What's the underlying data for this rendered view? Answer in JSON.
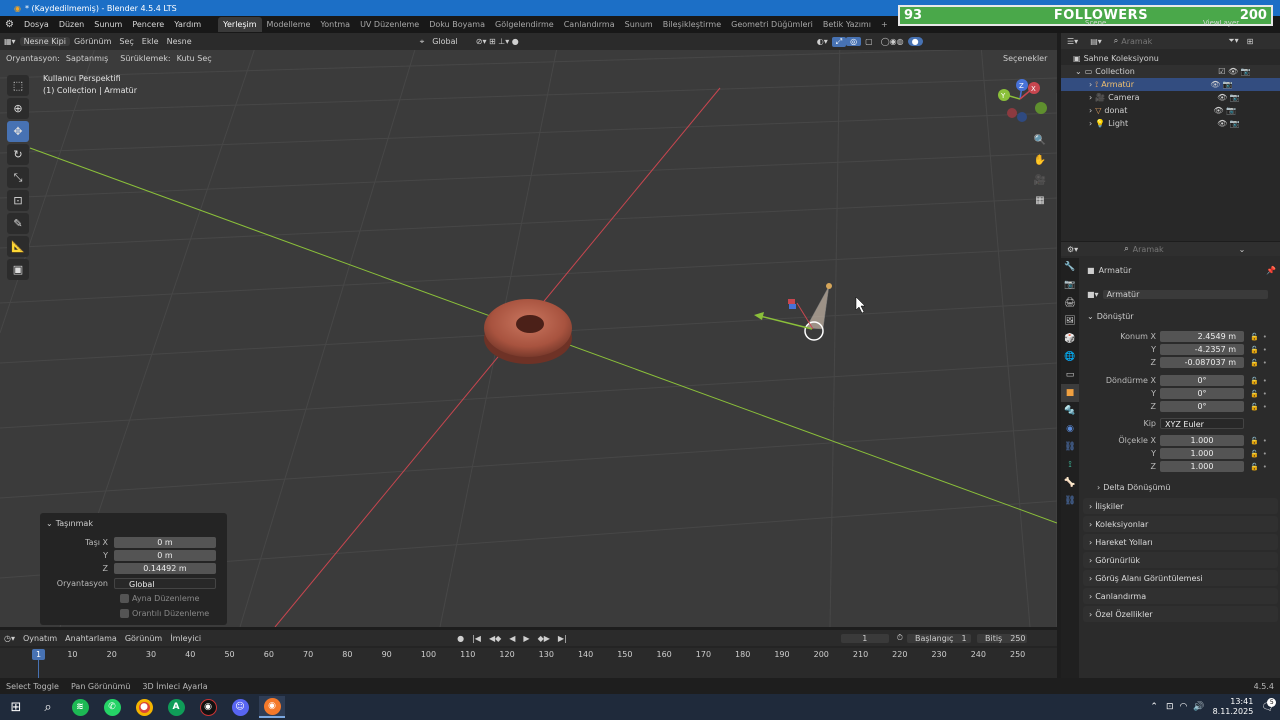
{
  "window": {
    "title": "* (Kaydedilmemiş) - Blender 4.5.4 LTS"
  },
  "overlay": {
    "left_count": "93",
    "label": "FOLLOWERS",
    "right_count": "200"
  },
  "menu": {
    "items": [
      "Dosya",
      "Düzen",
      "Sunum",
      "Pencere",
      "Yardım"
    ],
    "workspaces": [
      "Yerleşim",
      "Modelleme",
      "Yontma",
      "UV Düzenleme",
      "Doku Boyama",
      "Gölgelendirme",
      "Canlandırma",
      "Sunum",
      "Bileşikleştirme",
      "Geometri Düğümleri",
      "Betik Yazımı"
    ],
    "active_workspace": "Yerleşim",
    "scene_label": "Scene",
    "viewlayer_label": "ViewLayer"
  },
  "viewport_header": {
    "mode": "Nesne Kipi",
    "menus": [
      "Görünüm",
      "Seç",
      "Ekle",
      "Nesne"
    ],
    "transform_orientation": "Global",
    "orientation_label": "Oryantasyon:",
    "orientation_value": "Saptanmış",
    "drag_label": "Sürüklemek:",
    "drag_value": "Kutu Seç",
    "options_label": "Seçenekler"
  },
  "viewport_info": {
    "line1": "Kullanıcı Perspektifi",
    "line2": "(1) Collection | Armatür"
  },
  "operator_panel": {
    "title": "Taşınmak",
    "rows": [
      {
        "label": "Taşı X",
        "value": "0 m"
      },
      {
        "label": "Y",
        "value": "0 m"
      },
      {
        "label": "Z",
        "value": "0.14492 m"
      }
    ],
    "orientation_label": "Oryantasyon",
    "orientation_value": "Global",
    "checkboxes": [
      "Ayna Düzenleme",
      "Orantılı Düzenleme"
    ]
  },
  "outliner": {
    "search_placeholder": "Aramak",
    "scene_collection": "Sahne Koleksiyonu",
    "collection": "Collection",
    "items": [
      {
        "name": "Armatür",
        "selected": true
      },
      {
        "name": "Camera",
        "selected": false
      },
      {
        "name": "donat",
        "selected": false
      },
      {
        "name": "Light",
        "selected": false
      }
    ]
  },
  "properties": {
    "search_placeholder": "Aramak",
    "object_name": "Armatür",
    "datablock_name": "Armatür",
    "transform_title": "Dönüştür",
    "location_label": "Konum X",
    "location": [
      "2.4549 m",
      "-4.2357 m",
      "-0.087037 m"
    ],
    "rotation_label": "Döndürme X",
    "rotation": [
      "0°",
      "0°",
      "0°"
    ],
    "mode_label": "Kip",
    "mode_value": "XYZ Euler",
    "scale_label": "Ölçekle X",
    "scale": [
      "1.000",
      "1.000",
      "1.000"
    ],
    "axis_y": "Y",
    "axis_z": "Z",
    "delta": "Delta Dönüşümü",
    "sections": [
      "İlişkiler",
      "Koleksiyonlar",
      "Hareket Yolları",
      "Görünürlük",
      "Görüş Alanı Görüntülemesi",
      "Canlandırma",
      "Özel Özellikler"
    ]
  },
  "timeline": {
    "menus": [
      "Oynatım",
      "Anahtarlama",
      "Görünüm",
      "İmleyici"
    ],
    "current_frame": "1",
    "start_label": "Başlangıç",
    "start": "1",
    "end_label": "Bitiş",
    "end": "250",
    "ticks": [
      "10",
      "20",
      "30",
      "40",
      "50",
      "60",
      "70",
      "80",
      "90",
      "100",
      "110",
      "120",
      "130",
      "140",
      "150",
      "160",
      "170",
      "180",
      "190",
      "200",
      "210",
      "220",
      "230",
      "240",
      "250"
    ]
  },
  "statusbar": {
    "items": [
      "Select Toggle",
      "Pan Görünümü",
      "3D İmleci Ayarla"
    ],
    "version": "4.5.4"
  },
  "taskbar": {
    "time": "13:41",
    "date": "8.11.2025",
    "badge": "5"
  },
  "colors": {
    "accent": "#4772b3",
    "title_bar": "#1c6fc6",
    "overlay_bg": "#4aa84a",
    "x_axis": "#c8464f",
    "y_axis": "#8bc03a",
    "donut": "#b8604c"
  }
}
